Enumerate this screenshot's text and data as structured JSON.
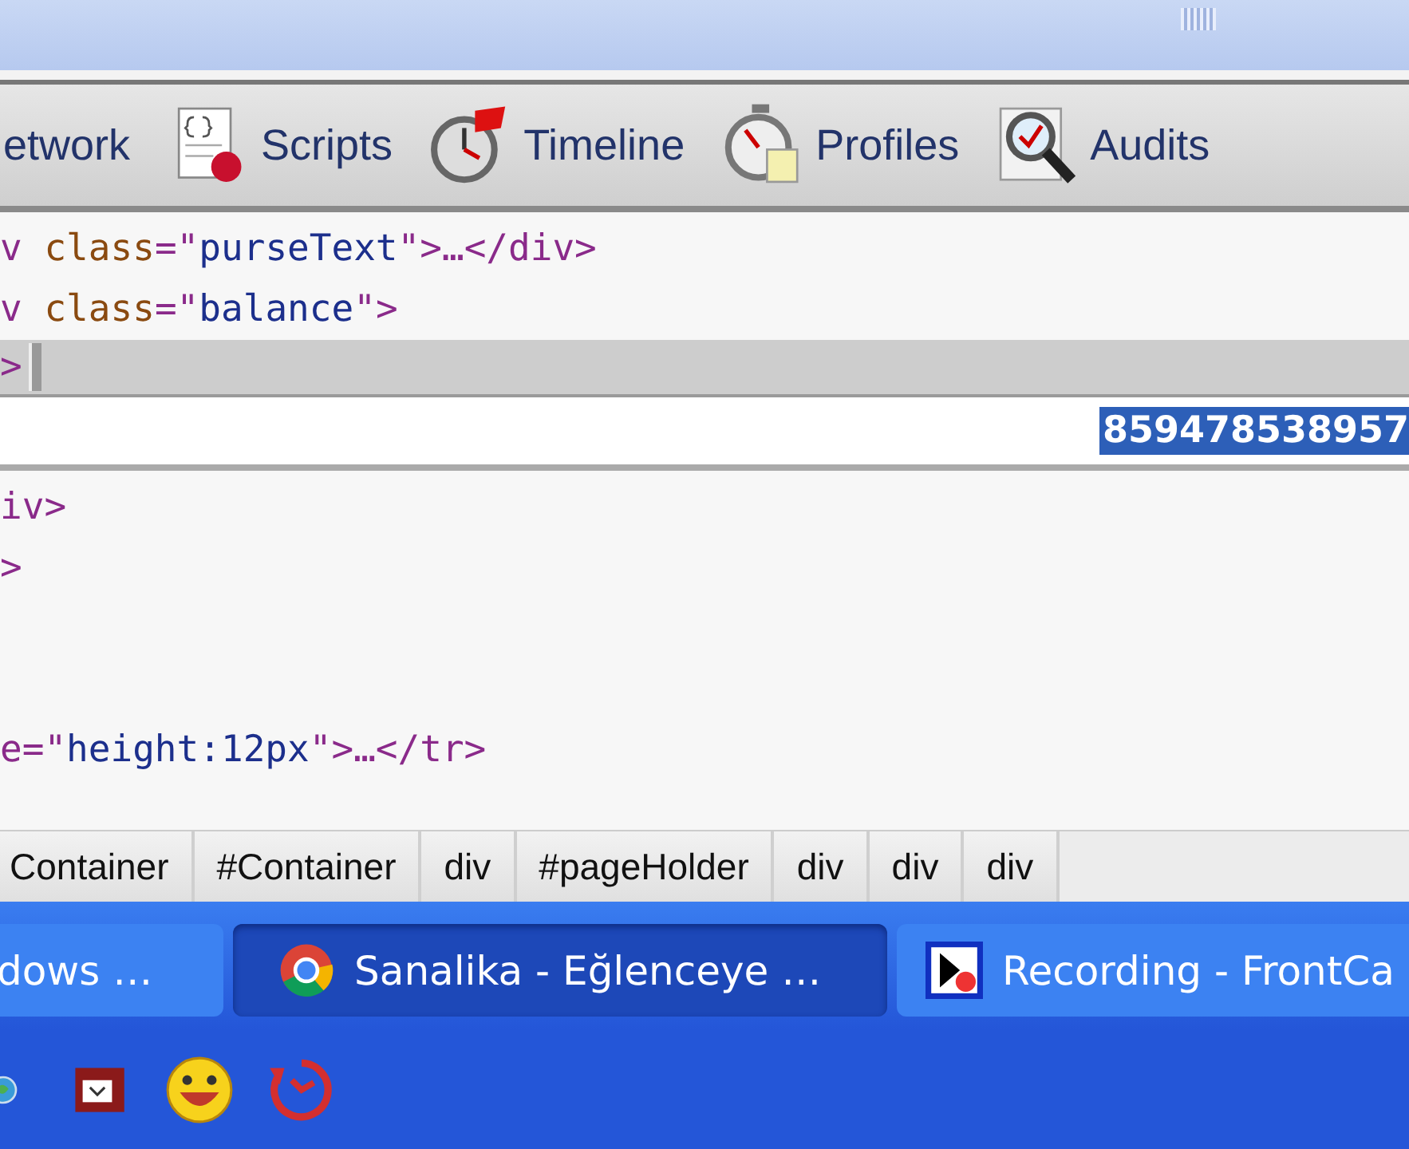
{
  "toolbar": {
    "items": [
      {
        "label": "etwork"
      },
      {
        "label": "Scripts"
      },
      {
        "label": "Timeline"
      },
      {
        "label": "Profiles"
      },
      {
        "label": "Audits"
      }
    ]
  },
  "code": {
    "lines": [
      {
        "kind": "code",
        "segments": [
          {
            "t": "v ",
            "kind": "tag"
          },
          {
            "t": "class",
            "kind": "attr"
          },
          {
            "t": "=\"",
            "kind": "tag"
          },
          {
            "t": "purseText",
            "kind": "value"
          },
          {
            "t": "\">…</div>",
            "kind": "tag"
          }
        ]
      },
      {
        "kind": "code",
        "segments": [
          {
            "t": "v ",
            "kind": "tag"
          },
          {
            "t": "class",
            "kind": "attr"
          },
          {
            "t": "=\"",
            "kind": "tag"
          },
          {
            "t": "balance",
            "kind": "value"
          },
          {
            "t": "\">",
            "kind": "tag"
          }
        ]
      },
      {
        "kind": "edit",
        "segments": [
          {
            "t": ">",
            "kind": "tag"
          }
        ]
      },
      {
        "kind": "selected",
        "segments": [
          {
            "t": "859478538957",
            "kind": "text"
          }
        ]
      },
      {
        "kind": "code",
        "segments": [
          {
            "t": "iv>",
            "kind": "tag"
          }
        ]
      },
      {
        "kind": "code",
        "segments": [
          {
            "t": ">",
            "kind": "tag"
          }
        ]
      },
      {
        "kind": "blank"
      },
      {
        "kind": "blank"
      },
      {
        "kind": "code",
        "segments": [
          {
            "t": "e=\"",
            "kind": "tag"
          },
          {
            "t": "height:12px",
            "kind": "value"
          },
          {
            "t": "\">…</tr>",
            "kind": "tag"
          }
        ]
      }
    ]
  },
  "breadcrumbs": [
    "Container",
    "#Container",
    "div",
    "#pageHolder",
    "div",
    "div",
    "div"
  ],
  "taskbar": {
    "tasks": [
      {
        "label": "dows …",
        "selected": false
      },
      {
        "label": "Sanalika - Eğlenceye …",
        "selected": true
      },
      {
        "label": "Recording - FrontCa",
        "selected": false
      }
    ]
  }
}
